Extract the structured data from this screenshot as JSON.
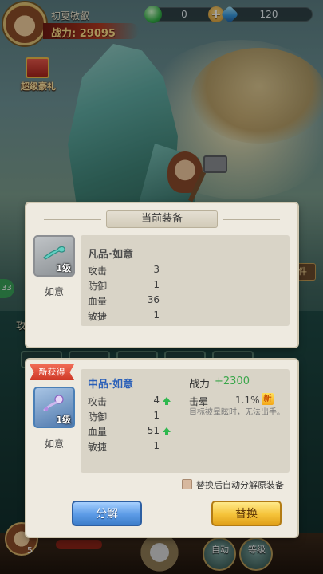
{
  "player": {
    "name": "初夏敏叡",
    "power_text": "战力: 29095"
  },
  "resources": [
    {
      "icon": "green-gem-icon",
      "value": "0"
    },
    {
      "icon": "blue-crystal-icon",
      "value": "120"
    }
  ],
  "gift": {
    "label": "超级豪礼"
  },
  "background_ui": {
    "side_badge": "33",
    "side_text": "攻",
    "right_tag": "事件",
    "bottom_num": "5",
    "bottom_buttons": [
      "自动",
      "等级"
    ]
  },
  "current_equipment": {
    "title": "当前装备",
    "item_name": "如意",
    "level": "1级",
    "equip_name": "凡品·如意",
    "stats": [
      {
        "label": "攻击",
        "value": "3"
      },
      {
        "label": "防御",
        "value": "1"
      },
      {
        "label": "血量",
        "value": "36"
      },
      {
        "label": "敏捷",
        "value": "1"
      }
    ]
  },
  "new_equipment": {
    "badge": "新获得",
    "item_name": "如意",
    "level": "1级",
    "equip_name": "中品·如意",
    "power_label": "战力",
    "power_change": "+2300",
    "stats": [
      {
        "label": "攻击",
        "value": "4",
        "up": true
      },
      {
        "label": "防御",
        "value": "1",
        "up": false
      },
      {
        "label": "血量",
        "value": "51",
        "up": true
      },
      {
        "label": "敏捷",
        "value": "1",
        "up": false
      }
    ],
    "skill": {
      "name": "击晕",
      "value": "1.1%",
      "new_tag": "新",
      "description": "目标被晕眩时，无法出手。"
    },
    "auto_decompose_label": "替换后自动分解原装备",
    "decompose_button": "分解",
    "replace_button": "替换"
  },
  "colors": {
    "power_up": "#3aa64a",
    "rare_name": "#2a5fb8",
    "decompose_btn": "#5c9be6",
    "replace_btn": "#f5c33a"
  }
}
